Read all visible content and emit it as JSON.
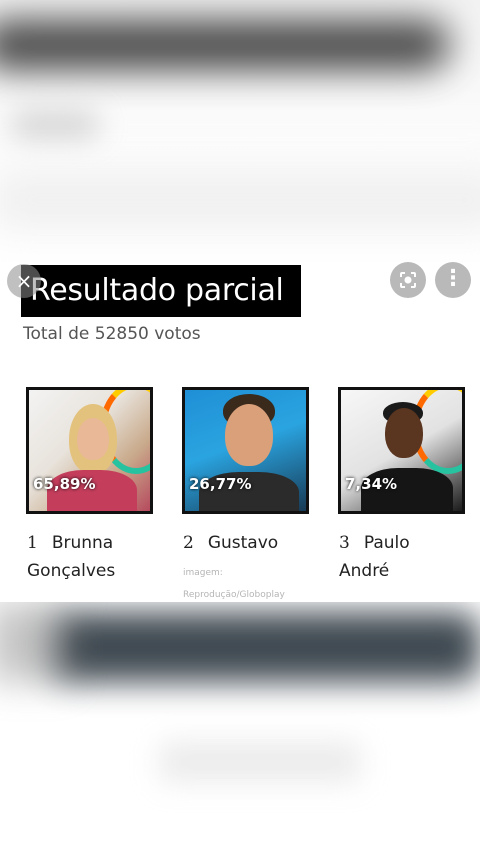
{
  "card": {
    "title": "Resultado parcial",
    "total": "Total de 52850 votos",
    "close_glyph": "×",
    "lens_icon": "lens-icon",
    "more_glyph": "⋮"
  },
  "candidates": [
    {
      "rank": "1",
      "first": "Brunna",
      "last": "Gonçalves",
      "percent": "65,89%"
    },
    {
      "rank": "2",
      "first": "Gustavo",
      "last": "",
      "percent": "26,77%"
    },
    {
      "rank": "3",
      "first": "Paulo",
      "last": "André",
      "percent": "7,34%"
    }
  ],
  "credits": {
    "c2_line1": "imagem:",
    "c2_line2": "Reprodução/Globoplay"
  }
}
